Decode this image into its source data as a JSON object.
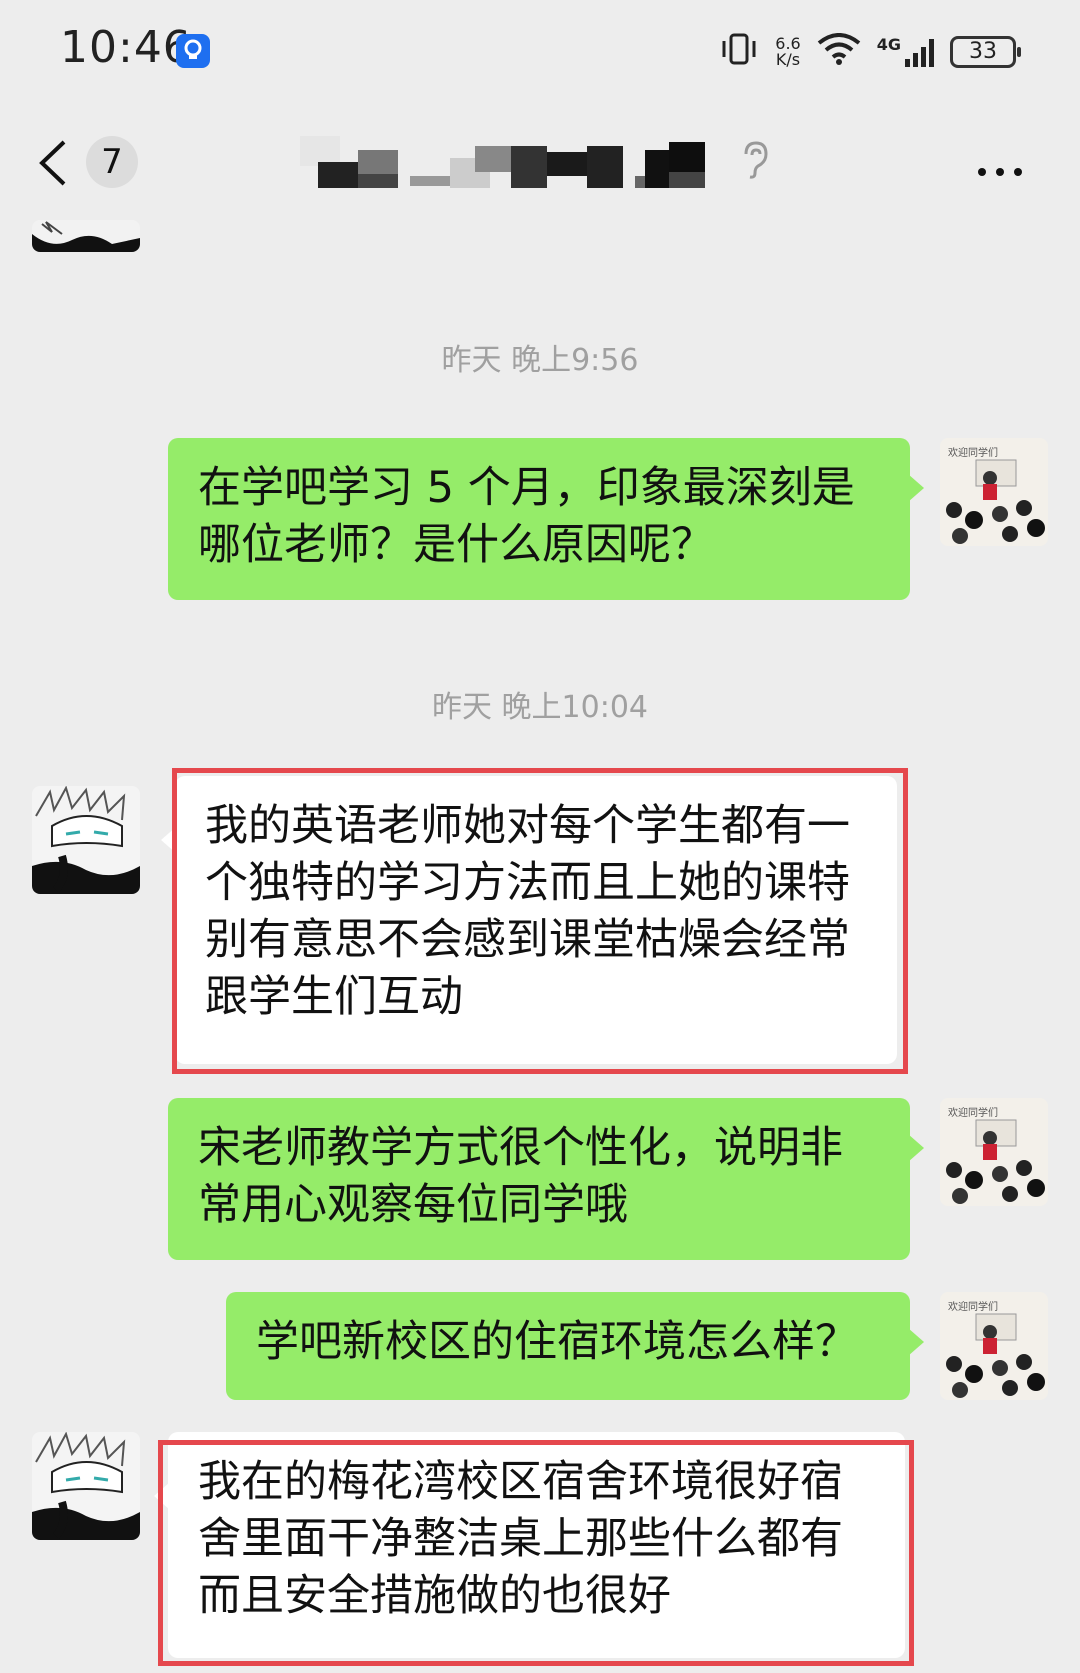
{
  "status_bar": {
    "time": "10:46",
    "net_speed_value": "6.6",
    "net_speed_unit": "K/s",
    "network_type": "4G",
    "battery": "33"
  },
  "navbar": {
    "back_count": "7",
    "title_obscured": true
  },
  "messages": [
    {
      "type": "timestamp",
      "text": "昨天 晚上9:56"
    },
    {
      "type": "bubble",
      "sender": "me",
      "text": "在学吧学习 5 个月，印象最深刻是哪位老师？是什么原因呢？"
    },
    {
      "type": "timestamp",
      "text": "昨天 晚上10:04"
    },
    {
      "type": "bubble",
      "sender": "them",
      "highlighted": true,
      "text": "我的英语老师她对每个学生都有一个独特的学习方法而且上她的课特别有意思不会感到课堂枯燥会经常跟学生们互动"
    },
    {
      "type": "bubble",
      "sender": "me",
      "text": "宋老师教学方式很个性化，说明非常用心观察每位同学哦"
    },
    {
      "type": "bubble",
      "sender": "me",
      "text": "学吧新校区的住宿环境怎么样？"
    },
    {
      "type": "bubble",
      "sender": "them",
      "highlighted": true,
      "text": "我在的梅花湾校区宿舍环境很好宿舍里面干净整洁桌上那些什么都有而且安全措施做的也很好"
    }
  ],
  "colors": {
    "background": "#ededed",
    "my_bubble": "#95ec69",
    "their_bubble": "#ffffff",
    "highlight_box": "#e5484d"
  },
  "icons": [
    "bulb-badge-icon",
    "vibrate-icon",
    "wifi-icon",
    "signal-icon",
    "battery-icon",
    "back-chevron-icon",
    "ear-icon",
    "more-icon"
  ]
}
